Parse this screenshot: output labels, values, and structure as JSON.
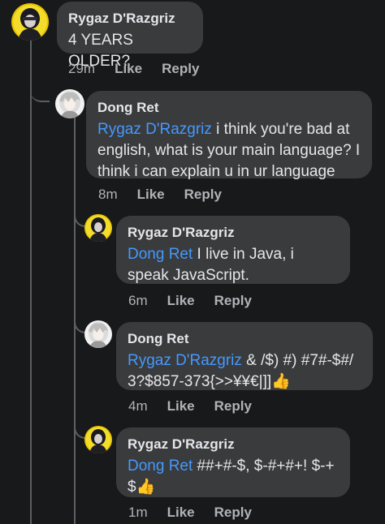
{
  "comments": [
    {
      "author": "Rygaz D'Razgriz",
      "mention": "",
      "text": "4 YEARS OLDER?",
      "emoji": "",
      "time": "29m",
      "like": "Like",
      "reply": "Reply"
    },
    {
      "author": "Dong Ret",
      "mention": "Rygaz D'Razgriz",
      "text": " i think you're bad at english, what is your main language? I think i can explain u in ur language",
      "emoji": "",
      "time": "8m",
      "like": "Like",
      "reply": "Reply"
    },
    {
      "author": "Rygaz D'Razgriz",
      "mention": "Dong Ret",
      "text": " I live in Java, i speak JavaScript.",
      "emoji": "",
      "time": "6m",
      "like": "Like",
      "reply": "Reply"
    },
    {
      "author": "Dong Ret",
      "mention": "Rygaz D'Razgriz",
      "text": " & /$) #) #7#-$#/ 3?$857-373{>>¥¥€|]]",
      "emoji": "👍",
      "time": "4m",
      "like": "Like",
      "reply": "Reply"
    },
    {
      "author": "Rygaz D'Razgriz",
      "mention": "Dong Ret",
      "text": " ##+#-$, $-#+#+! $-+ $",
      "emoji": "👍",
      "time": "1m",
      "like": "Like",
      "reply": "Reply"
    }
  ],
  "icons": {
    "avatar_rygaz": "avatar-dark-anime-character",
    "avatar_dong": "avatar-white-haired-character",
    "thumbs_up": "thumbs-up-emoji"
  },
  "colors": {
    "background": "#18191a",
    "bubble": "#3a3b3c",
    "mention": "#4599ff",
    "text": "#e4e6eb",
    "meta": "#b0b3b8"
  }
}
